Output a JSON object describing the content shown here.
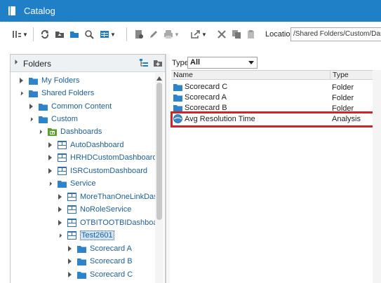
{
  "app": {
    "title": "Catalog",
    "book_icon": "catalog-book-icon"
  },
  "toolbar": {
    "location_label": "Location",
    "location_value": "/Shared Folders/Custom/Dashboards/"
  },
  "folders_panel": {
    "title": "Folders",
    "tree": [
      {
        "label": "My Folders"
      },
      {
        "label": "Shared Folders"
      },
      {
        "label": "Common Content"
      },
      {
        "label": "Custom"
      },
      {
        "label": "Dashboards"
      },
      {
        "label": "AutoDashboard"
      },
      {
        "label": "HRHDCustomDashboard"
      },
      {
        "label": "ISRCustomDashboard"
      },
      {
        "label": "Service"
      },
      {
        "label": "MoreThanOneLinkDashboard"
      },
      {
        "label": "NoRoleService"
      },
      {
        "label": "OTBITOOTBIDashboard"
      },
      {
        "label": "Test2601"
      },
      {
        "label": "Scorecard A"
      },
      {
        "label": "Scorecard B"
      },
      {
        "label": "Scorecard C"
      }
    ]
  },
  "content_panel": {
    "type_filter_label": "Type",
    "type_filter_value": "All",
    "columns": {
      "name": "Name",
      "type": "Type"
    },
    "rows": [
      {
        "name": "Scorecard C",
        "type": "Folder"
      },
      {
        "name": "Scorecard A",
        "type": "Folder"
      },
      {
        "name": "Scorecard B",
        "type": "Folder"
      },
      {
        "name": "Avg Resolution Time",
        "type": "Analysis"
      }
    ]
  },
  "colors": {
    "title_bar": "#1f7fc7",
    "highlight_border": "#d6202a",
    "link": "#1b5f9c"
  }
}
